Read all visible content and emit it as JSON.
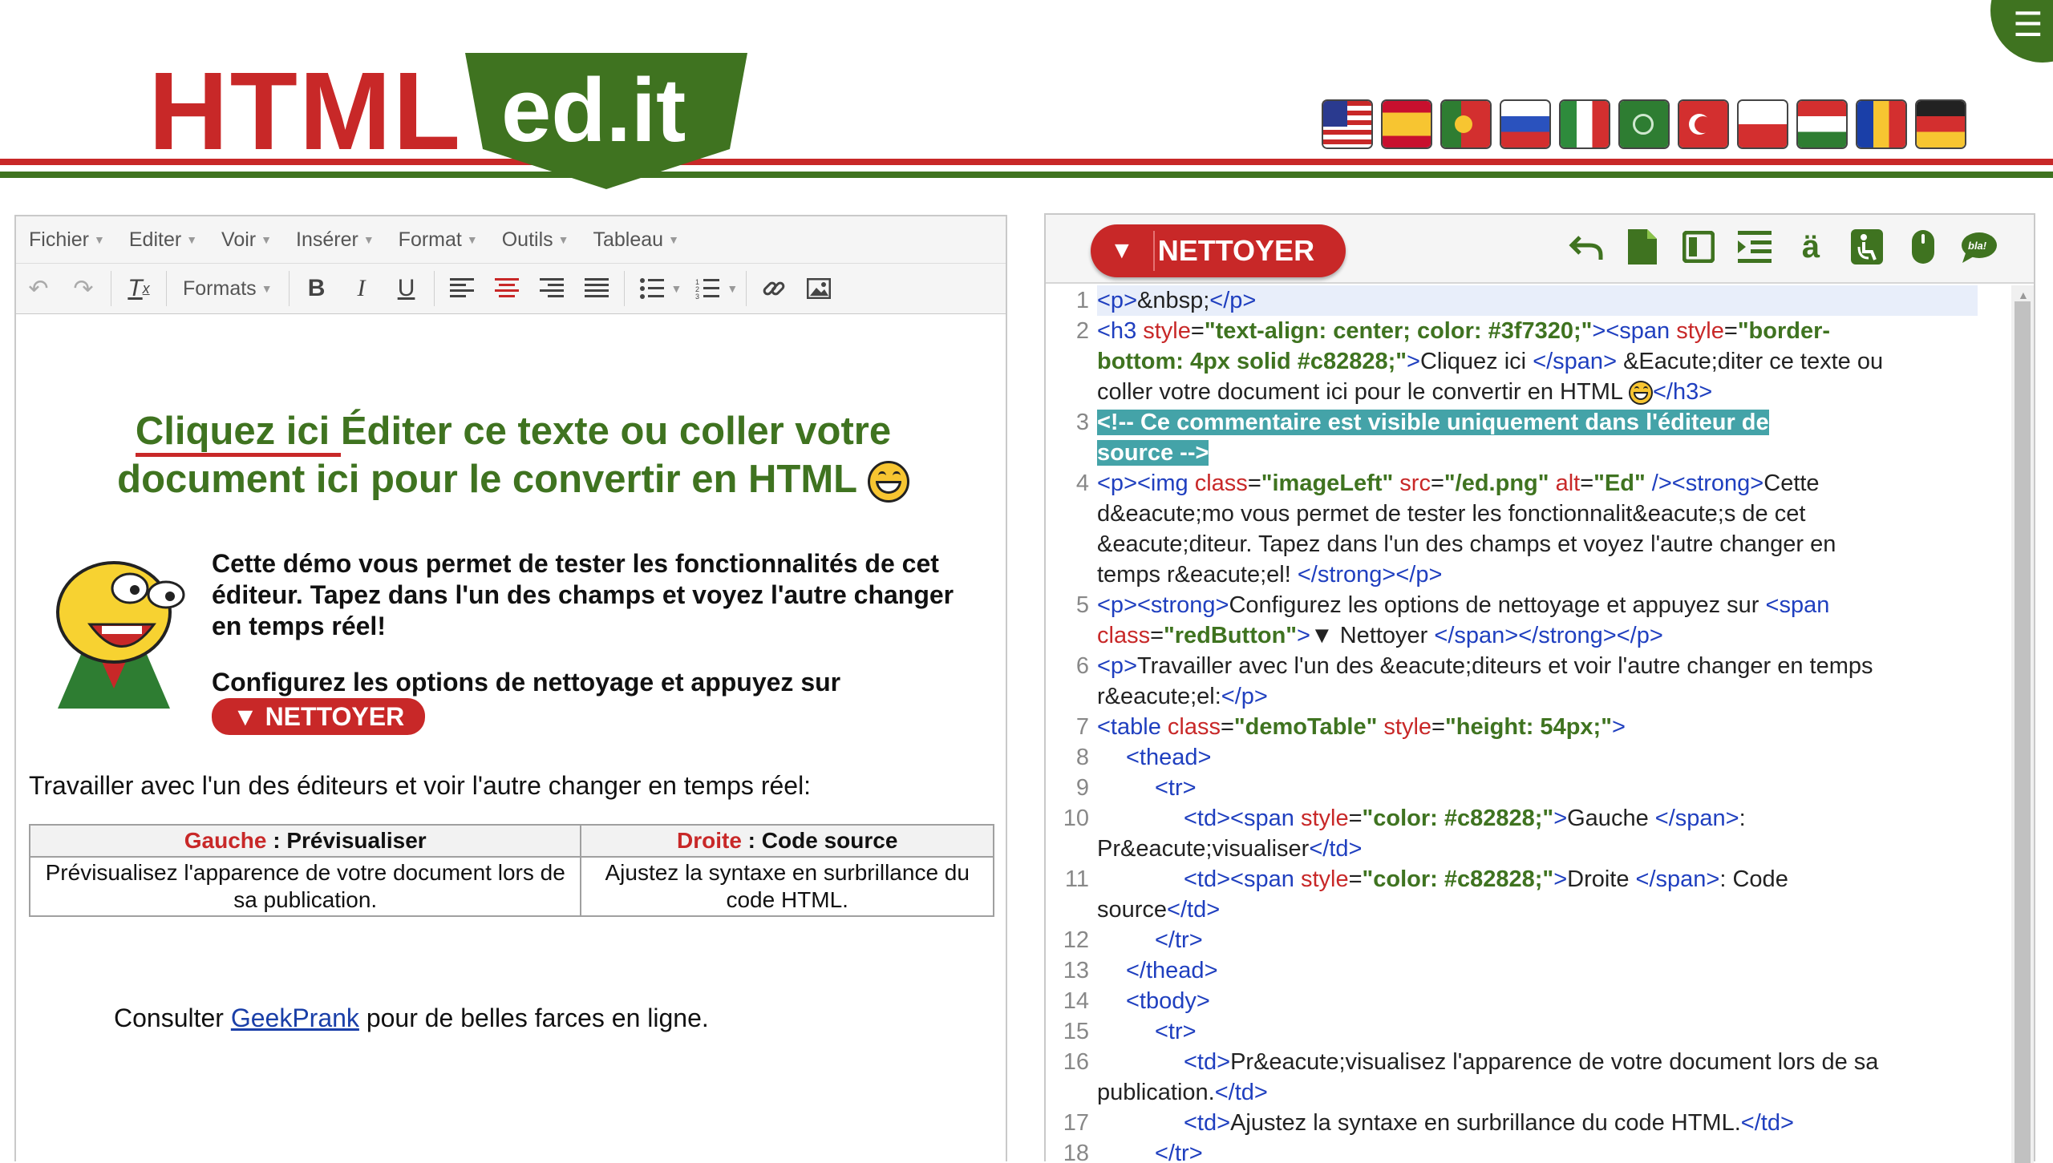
{
  "header": {
    "logo_left": "HTML",
    "logo_right": "ed.it",
    "menu_icon": "menu-icon",
    "flags": [
      "flag-us",
      "flag-es",
      "flag-pt",
      "flag-ru",
      "flag-it",
      "flag-ar",
      "flag-tr",
      "flag-pl",
      "flag-hu",
      "flag-ro",
      "flag-de"
    ]
  },
  "left": {
    "menubar": [
      "Fichier",
      "Editer",
      "Voir",
      "Insérer",
      "Format",
      "Outils",
      "Tableau"
    ],
    "toolbar": {
      "formats_label": "Formats",
      "bold": "B",
      "italic": "I",
      "underline": "U"
    },
    "doc": {
      "title_underlined": "Cliquez ici ",
      "title_rest": "Éditer ce texte ou coller votre document ici pour le convertir en HTML",
      "p1": "Cette démo vous permet de tester les fonctionnalités de cet éditeur. Tapez dans l'un des champs et voyez l'autre changer en temps réel!",
      "p2": "Configurez les options de nettoyage et appuyez sur",
      "p2_button": "▼ NETTOYER",
      "p3": "Travailler avec l'un des éditeurs et voir l'autre changer en temps réel:",
      "table": {
        "h1_red": "Gauche",
        "h1_rest": " : Prévisualiser",
        "h2_red": "Droite",
        "h2_rest": " : Code source",
        "c1": "Prévisualisez l'apparence de votre document lors de sa publication.",
        "c2": "Ajustez la syntaxe en surbrillance du code HTML."
      },
      "p4_before": "Consulter ",
      "p4_link": "GeekPrank",
      "p4_after": " pour de belles farces en ligne."
    }
  },
  "right": {
    "clean_arrow": "▼",
    "clean_label": "NETTOYER",
    "icons": [
      "undo-icon",
      "new-document-icon",
      "layout-icon",
      "indent-icon",
      "character-icon",
      "accessibility-icon",
      "mouse-icon",
      "chat-bubble-icon"
    ],
    "chat_text": "bla!",
    "line_numbers": [
      "1",
      "2",
      "3",
      "4",
      "5",
      "6",
      "7",
      "8",
      "9",
      "10",
      "11",
      "12",
      "13",
      "14",
      "15",
      "16",
      "17",
      "18"
    ],
    "code": {
      "l1": [
        "<p>",
        "&nbsp;",
        "</p>"
      ],
      "l2a": [
        "<h3 ",
        "style",
        "=",
        "\"text-align: center; color: #3f7320;\"",
        "><span ",
        "style",
        "=",
        "\"border-"
      ],
      "l2b": [
        "bottom: 4px solid #c82828;\"",
        ">",
        "Cliquez ici ",
        "</span>",
        " &Eacute;diter ce texte ou"
      ],
      "l2c": [
        "coller votre document ici pour le convertir en HTML ",
        "</h3>"
      ],
      "l3a": "<!-- Ce commentaire est visible uniquement dans l'éditeur de",
      "l3b": "source -->",
      "l4a": [
        "<p><img ",
        "class",
        "=",
        "\"imageLeft\"",
        " ",
        "src",
        "=",
        "\"/ed.png\"",
        " ",
        "alt",
        "=",
        "\"Ed\"",
        " /><strong>",
        "Cette"
      ],
      "l4b": "d&eacute;mo vous permet de tester les fonctionnalit&eacute;s de cet",
      "l4c": "&eacute;diteur. Tapez dans l'un des champs et voyez l'autre changer en",
      "l4d": [
        "temps r&eacute;el! ",
        "</strong></p>"
      ],
      "l5a": [
        "<p><strong>",
        "Configurez les options de nettoyage et appuyez sur ",
        "<span"
      ],
      "l5b": [
        "class",
        "=",
        "\"redButton\"",
        ">",
        "▼ Nettoyer ",
        "</span></strong></p>"
      ],
      "l6a": [
        "<p>",
        "Travailler avec l'un des &eacute;diteurs et voir l'autre changer en temps"
      ],
      "l6b": [
        "r&eacute;el:",
        "</p>"
      ],
      "l7": [
        "<table ",
        "class",
        "=",
        "\"demoTable\"",
        " ",
        "style",
        "=",
        "\"height: 54px;\"",
        ">"
      ],
      "l8": "<thead>",
      "l9": "<tr>",
      "l10a": [
        "<td><span ",
        "style",
        "=",
        "\"color: #c82828;\"",
        ">",
        "Gauche ",
        "</span>",
        ":"
      ],
      "l10b": [
        "Pr&eacute;visualiser",
        "</td>"
      ],
      "l11a": [
        "<td><span ",
        "style",
        "=",
        "\"color: #c82828;\"",
        ">",
        "Droite ",
        "</span>",
        ": Code"
      ],
      "l11b": [
        "source",
        "</td>"
      ],
      "l12": "</tr>",
      "l13": "</thead>",
      "l14": "<tbody>",
      "l15": "<tr>",
      "l16a": [
        "<td>",
        "Pr&eacute;visualisez l'apparence de votre document lors de sa"
      ],
      "l16b": [
        "publication.",
        "</td>"
      ],
      "l17": [
        "<td>",
        "Ajustez la syntaxe en surbrillance du code HTML.",
        "</td>"
      ],
      "l18": "</tr>"
    }
  }
}
